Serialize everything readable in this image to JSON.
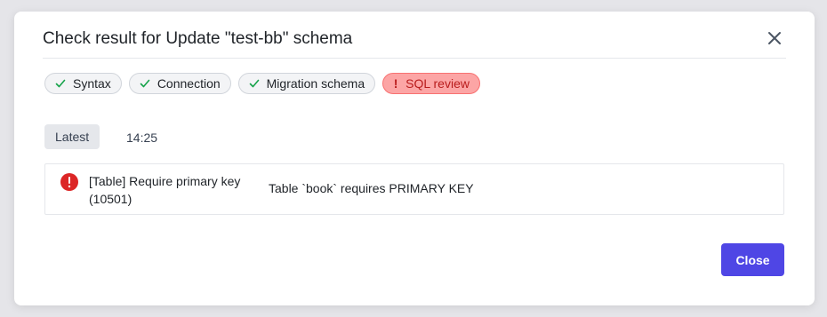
{
  "dialog": {
    "title": "Check result for Update \"test-bb\" schema",
    "close_icon": "close-icon"
  },
  "tabs": [
    {
      "label": "Syntax",
      "status": "success",
      "icon": "check-icon"
    },
    {
      "label": "Connection",
      "status": "success",
      "icon": "check-icon"
    },
    {
      "label": "Migration schema",
      "status": "success",
      "icon": "check-icon"
    },
    {
      "label": "SQL review",
      "status": "error",
      "icon": "exclamation-icon",
      "icon_text": "!"
    }
  ],
  "history": {
    "badge": "Latest",
    "time": "14:25"
  },
  "results": [
    {
      "status": "error",
      "icon": "error-circle-icon",
      "rule": "[Table] Require primary key (10501)",
      "message": "Table `book` requires PRIMARY KEY"
    }
  ],
  "footer": {
    "close_label": "Close"
  },
  "colors": {
    "accent": "#4f46e5",
    "success": "#16a34a",
    "error": "#dc2626",
    "error_tab_bg": "#fca5a5",
    "error_tab_text": "#b91c1c"
  }
}
